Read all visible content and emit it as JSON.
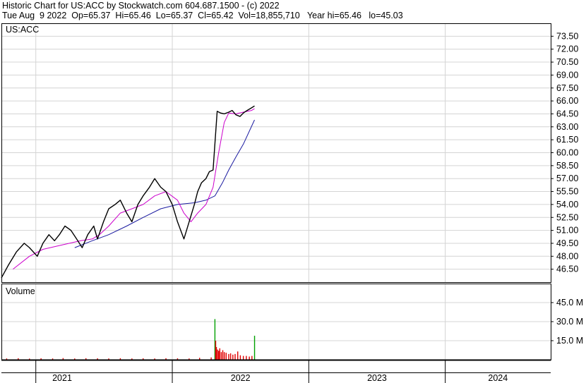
{
  "header": {
    "line1": "Historic Chart for US:ACC by Stockwatch.com 604.687.1500 - (c) 2022",
    "line2": "Tue Aug  9 2022  Op=65.37  Hi=65.46  Lo=65.37  Cl=65.42  Vol=18,855,710   Year hi=65.46   lo=45.03"
  },
  "chart_data": [
    {
      "type": "line",
      "name": "price",
      "title": "US:ACC",
      "x_axis": {
        "labels": [
          "2021",
          "2022",
          "2023",
          "2024"
        ]
      },
      "y_ticks": [
        "73.50",
        "72.00",
        "70.50",
        "69.00",
        "67.50",
        "66.00",
        "64.50",
        "63.00",
        "61.50",
        "60.00",
        "58.50",
        "57.00",
        "55.50",
        "54.00",
        "52.50",
        "51.00",
        "49.50",
        "48.00",
        "46.50"
      ],
      "ylim": [
        45.0,
        75.0
      ],
      "grid": true,
      "price": {
        "x": [
          "2020-10-01",
          "2020-10-20",
          "2020-11-10",
          "2020-12-01",
          "2020-12-15",
          "2021-01-05",
          "2021-01-20",
          "2021-02-05",
          "2021-02-20",
          "2021-03-05",
          "2021-03-20",
          "2021-04-05",
          "2021-04-20",
          "2021-05-05",
          "2021-05-20",
          "2021-06-05",
          "2021-06-15",
          "2021-07-01",
          "2021-07-15",
          "2021-08-01",
          "2021-08-15",
          "2021-09-01",
          "2021-09-15",
          "2021-10-01",
          "2021-10-15",
          "2021-11-01",
          "2021-11-15",
          "2021-12-01",
          "2021-12-15",
          "2022-01-01",
          "2022-01-15",
          "2022-02-01",
          "2022-02-15",
          "2022-03-01",
          "2022-03-10",
          "2022-03-20",
          "2022-04-01",
          "2022-04-10",
          "2022-04-20",
          "2022-05-01",
          "2022-05-10",
          "2022-05-20",
          "2022-06-01",
          "2022-06-10",
          "2022-06-20",
          "2022-07-01",
          "2022-07-10",
          "2022-07-20",
          "2022-08-01",
          "2022-08-09"
        ],
        "y": [
          45.5,
          47.0,
          48.5,
          49.5,
          49.0,
          48.0,
          49.5,
          50.5,
          49.8,
          50.5,
          51.5,
          51.0,
          50.0,
          49.0,
          50.5,
          51.5,
          50.0,
          52.0,
          53.5,
          54.0,
          54.5,
          53.0,
          52.0,
          54.0,
          55.0,
          56.0,
          57.0,
          56.0,
          55.5,
          54.0,
          52.0,
          50.0,
          52.0,
          54.0,
          55.5,
          56.5,
          57.0,
          57.8,
          58.0,
          64.8,
          64.6,
          64.5,
          64.7,
          64.9,
          64.4,
          64.2,
          64.6,
          64.9,
          65.2,
          65.42
        ]
      },
      "ma_short": {
        "color": "#cc00cc",
        "x": [
          "2020-11-01",
          "2020-12-15",
          "2021-01-20",
          "2021-03-01",
          "2021-04-01",
          "2021-05-01",
          "2021-06-01",
          "2021-06-20",
          "2021-07-15",
          "2021-08-15",
          "2021-09-15",
          "2021-10-15",
          "2021-11-15",
          "2021-12-15",
          "2022-01-15",
          "2022-02-01",
          "2022-02-20",
          "2022-03-10",
          "2022-04-01",
          "2022-04-20",
          "2022-05-05",
          "2022-05-20",
          "2022-06-01",
          "2022-06-20",
          "2022-07-10",
          "2022-08-01",
          "2022-08-09"
        ],
        "y": [
          46.5,
          48.0,
          48.8,
          49.2,
          49.5,
          49.8,
          50.0,
          50.5,
          51.5,
          53.0,
          53.5,
          54.0,
          55.0,
          55.5,
          54.5,
          53.0,
          52.0,
          53.0,
          54.0,
          56.0,
          60.0,
          63.5,
          64.6,
          64.5,
          64.7,
          64.9,
          65.1
        ]
      },
      "ma_long": {
        "color": "#1a1aa0",
        "x": [
          "2021-04-15",
          "2021-06-01",
          "2021-07-15",
          "2021-09-01",
          "2021-10-15",
          "2021-12-01",
          "2022-01-15",
          "2022-03-01",
          "2022-04-01",
          "2022-04-25",
          "2022-05-15",
          "2022-06-01",
          "2022-06-20",
          "2022-07-10",
          "2022-08-09"
        ],
        "y": [
          49.0,
          49.8,
          50.5,
          51.5,
          52.5,
          53.5,
          54.0,
          54.2,
          54.5,
          55.0,
          56.5,
          58.0,
          59.5,
          61.0,
          63.8
        ]
      }
    },
    {
      "type": "bar",
      "name": "volume",
      "title": "Volume",
      "y_ticks": [
        "45.0 M",
        "30.0 M",
        "15.0 M"
      ],
      "ylim": [
        0,
        60
      ],
      "unit": "M",
      "colors": {
        "up": "#00a000",
        "down": "#e00000"
      },
      "values": [
        {
          "x": "2020-10-15",
          "v": 1.0
        },
        {
          "x": "2020-11-15",
          "v": 1.2
        },
        {
          "x": "2020-12-15",
          "v": 0.9
        },
        {
          "x": "2021-01-15",
          "v": 1.1
        },
        {
          "x": "2021-02-15",
          "v": 1.0
        },
        {
          "x": "2021-03-15",
          "v": 1.3
        },
        {
          "x": "2021-04-15",
          "v": 1.0
        },
        {
          "x": "2021-05-15",
          "v": 1.2
        },
        {
          "x": "2021-06-15",
          "v": 1.1
        },
        {
          "x": "2021-07-15",
          "v": 1.0
        },
        {
          "x": "2021-08-15",
          "v": 1.2
        },
        {
          "x": "2021-09-15",
          "v": 1.0
        },
        {
          "x": "2021-10-15",
          "v": 1.1
        },
        {
          "x": "2021-11-15",
          "v": 1.0
        },
        {
          "x": "2021-12-15",
          "v": 1.2
        },
        {
          "x": "2022-01-15",
          "v": 1.1
        },
        {
          "x": "2022-02-15",
          "v": 1.0
        },
        {
          "x": "2022-03-15",
          "v": 1.5
        },
        {
          "x": "2022-04-15",
          "v": 1.8
        },
        {
          "x": "2022-04-25",
          "v": 32.0,
          "up": true
        },
        {
          "x": "2022-04-27",
          "v": 15.0
        },
        {
          "x": "2022-04-29",
          "v": 10.0
        },
        {
          "x": "2022-05-02",
          "v": 8.0
        },
        {
          "x": "2022-05-05",
          "v": 7.0
        },
        {
          "x": "2022-05-08",
          "v": 9.0
        },
        {
          "x": "2022-05-12",
          "v": 6.0
        },
        {
          "x": "2022-05-16",
          "v": 7.5
        },
        {
          "x": "2022-05-20",
          "v": 6.0
        },
        {
          "x": "2022-05-25",
          "v": 5.5
        },
        {
          "x": "2022-06-01",
          "v": 4.5
        },
        {
          "x": "2022-06-06",
          "v": 5.0
        },
        {
          "x": "2022-06-12",
          "v": 4.0
        },
        {
          "x": "2022-06-18",
          "v": 4.5
        },
        {
          "x": "2022-06-25",
          "v": 6.5
        },
        {
          "x": "2022-07-02",
          "v": 3.5
        },
        {
          "x": "2022-07-10",
          "v": 3.0
        },
        {
          "x": "2022-07-18",
          "v": 3.0
        },
        {
          "x": "2022-07-26",
          "v": 2.5
        },
        {
          "x": "2022-08-02",
          "v": 3.0
        },
        {
          "x": "2022-08-09",
          "v": 18.9,
          "up": true
        }
      ]
    }
  ]
}
